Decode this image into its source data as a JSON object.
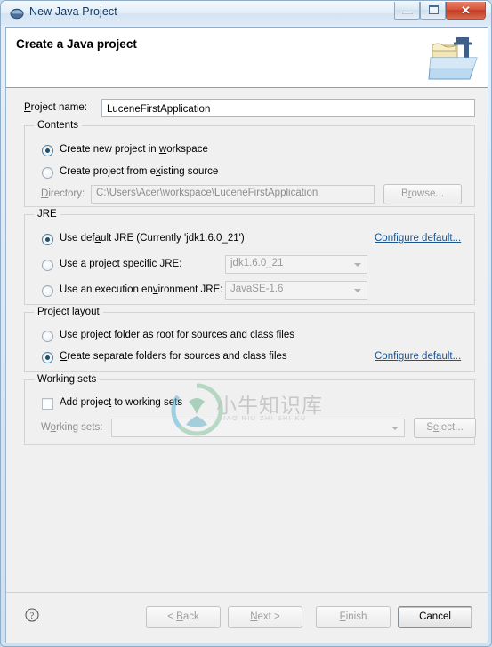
{
  "window": {
    "title": "New Java Project",
    "app_icon": "eclipse-sphere-icon",
    "controls": {
      "minimize": "minimize-icon",
      "maximize": "restore-icon",
      "close": "✕"
    }
  },
  "header": {
    "title": "Create a Java project",
    "icon": "java-project-folder-icon"
  },
  "project_name": {
    "label_pre": "P",
    "label_post": "roject name:",
    "value": "LuceneFirstApplication",
    "placeholder": ""
  },
  "contents": {
    "legend": "Contents",
    "options": [
      {
        "pre": "Create new project in ",
        "mnemonic": "w",
        "post": "orkspace",
        "checked": true,
        "disabled": false
      },
      {
        "pre": "Create project from e",
        "mnemonic": "x",
        "post": "isting source",
        "checked": false,
        "disabled": false
      }
    ],
    "directory": {
      "label_pre": "D",
      "label_post": "irectory:",
      "value": "C:\\Users\\Acer\\workspace\\LuceneFirstApplication",
      "browse_pre": "B",
      "browse_mnemonic": "r",
      "browse_post": "owse..."
    }
  },
  "jre": {
    "legend": "JRE",
    "options": [
      {
        "pre": "Use def",
        "mnemonic": "a",
        "post": "ult JRE (Currently 'jdk1.6.0_21')",
        "checked": true
      },
      {
        "pre": "U",
        "mnemonic": "s",
        "post": "e a project specific JRE:",
        "checked": false
      },
      {
        "pre": "Use an execution en",
        "mnemonic": "v",
        "post": "ironment JRE:",
        "checked": false
      }
    ],
    "specific_jre_value": "jdk1.6.0_21",
    "execution_env_value": "JavaSE-1.6",
    "configure_link": "Configure default..."
  },
  "project_layout": {
    "legend": "Project layout",
    "options": [
      {
        "pre": "",
        "mnemonic": "U",
        "post": "se project folder as root for sources and class files",
        "checked": false
      },
      {
        "pre": "",
        "mnemonic": "C",
        "post": "reate separate folders for sources and class files",
        "checked": true
      }
    ],
    "configure_link": "Configure default..."
  },
  "working_sets": {
    "legend": "Working sets",
    "checkbox": {
      "pre": "Add projec",
      "mnemonic": "t",
      "post": " to working sets",
      "checked": false
    },
    "label_pre": "W",
    "label_mnemonic": "o",
    "label_post": "rking sets:",
    "value": "",
    "select_pre": "S",
    "select_mnemonic": "e",
    "select_post": "lect..."
  },
  "watermark": {
    "chinese": "小牛知识库",
    "pinyin": "XIAO NIU ZHI SHI KU"
  },
  "footer": {
    "help_icon": "help-question-icon",
    "buttons": [
      {
        "pre": "< ",
        "mnemonic": "B",
        "post": "ack",
        "enabled": false
      },
      {
        "pre": "",
        "mnemonic": "N",
        "post": "ext >",
        "enabled": false
      },
      {
        "pre": "",
        "mnemonic": "F",
        "post": "inish",
        "enabled": false
      },
      {
        "pre": "",
        "mnemonic": "",
        "post": "Cancel",
        "enabled": true
      }
    ]
  },
  "colors": {
    "accent_link": "#1a5490",
    "titlebar": "#dce8f4",
    "body": "#f0f0f0",
    "close_button": "#c33c22",
    "radio_dot": "#1d4f6e"
  }
}
